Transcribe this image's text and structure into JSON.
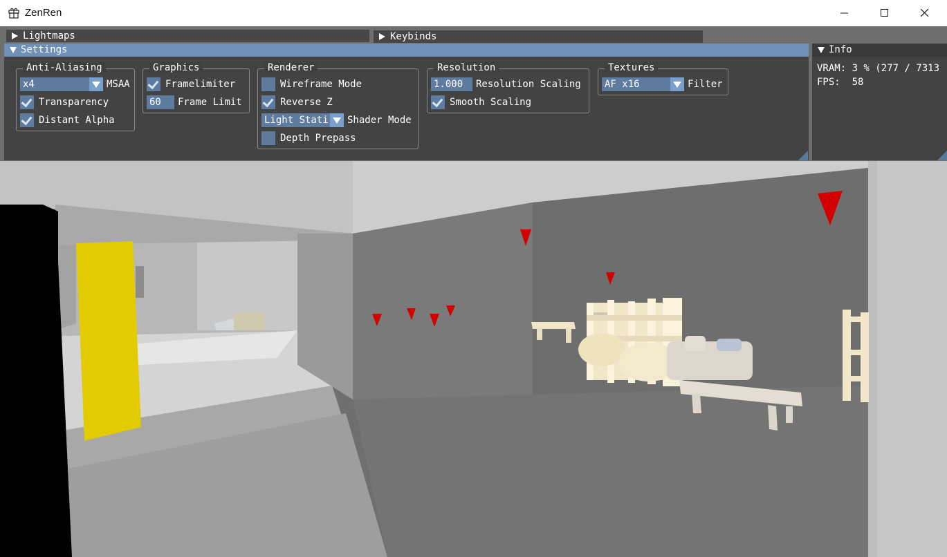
{
  "window": {
    "title": "ZenRen",
    "icon": "gift-icon",
    "controls": [
      "minimize-icon",
      "maximize-icon",
      "close-icon"
    ]
  },
  "headers": {
    "lightmaps": "Lightmaps",
    "keybinds": "Keybinds",
    "settings": "Settings",
    "info": "Info"
  },
  "settings": {
    "anti_aliasing": {
      "title": "Anti-Aliasing",
      "msaa_value": "x4",
      "msaa_label": "MSAA",
      "transparency_label": "Transparency",
      "transparency_checked": true,
      "distant_alpha_label": "Distant Alpha",
      "distant_alpha_checked": true
    },
    "graphics": {
      "title": "Graphics",
      "framelimiter_label": "Framelimiter",
      "framelimiter_checked": true,
      "frame_limit_value": "60",
      "frame_limit_label": "Frame Limit"
    },
    "renderer": {
      "title": "Renderer",
      "wireframe_label": "Wireframe Mode",
      "wireframe_checked": false,
      "reverse_z_label": "Reverse Z",
      "reverse_z_checked": true,
      "shader_mode_value": "Light Stati",
      "shader_mode_label": "Shader Mode",
      "depth_prepass_label": "Depth Prepass",
      "depth_prepass_checked": false
    },
    "resolution": {
      "title": "Resolution",
      "scaling_value": "1.000",
      "scaling_label": "Resolution Scaling",
      "smooth_label": "Smooth Scaling",
      "smooth_checked": true
    },
    "textures": {
      "title": "Textures",
      "filter_value": "AF x16",
      "filter_label": "Filter"
    }
  },
  "info": {
    "vram_line": "VRAM: 3 % (277 / 7313",
    "fps_line": "FPS:  58"
  },
  "colors": {
    "header_active": "#6f90b7",
    "frame_bg": "#5e7ba0",
    "panel_bg": "#404040",
    "marker_red": "#d40000",
    "door_yellow": "#e2cb00",
    "furniture": "#f1e6c8"
  }
}
